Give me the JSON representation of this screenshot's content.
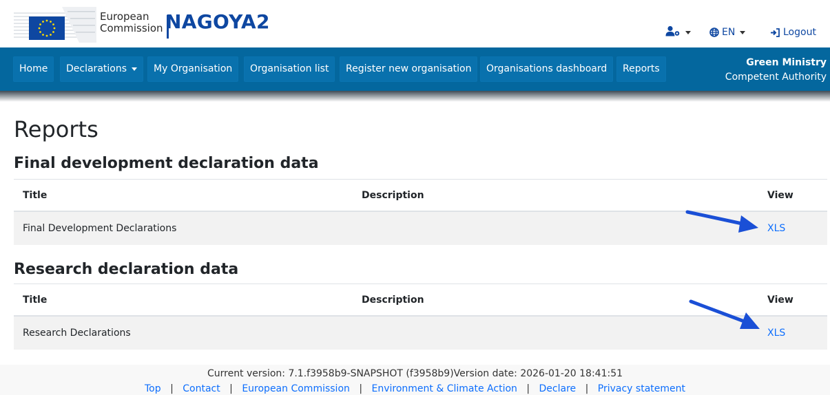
{
  "header": {
    "logo_text_line1": "European",
    "logo_text_line2": "Commission",
    "app_title": "NAGOYA2",
    "user_menu_icon": "user-cog-icon",
    "language_icon": "globe-icon",
    "language": "EN",
    "logout_icon": "sign-out-icon",
    "logout_label": "Logout"
  },
  "navbar": {
    "items": [
      {
        "label": "Home"
      },
      {
        "label": "Declarations",
        "dropdown": true
      },
      {
        "label": "My Organisation"
      },
      {
        "label": "Organisation list"
      },
      {
        "label": "Register new organisation"
      },
      {
        "label": "Organisations dashboard"
      },
      {
        "label": "Reports"
      }
    ],
    "org_name": "Green Ministry",
    "org_role": "Competent Authority"
  },
  "page": {
    "title": "Reports",
    "sections": [
      {
        "heading": "Final development declaration data",
        "columns": [
          "Title",
          "Description",
          "View"
        ],
        "rows": [
          {
            "title": "Final Development Declarations",
            "description": "",
            "view": "XLS"
          }
        ]
      },
      {
        "heading": "Research declaration data",
        "columns": [
          "Title",
          "Description",
          "View"
        ],
        "rows": [
          {
            "title": "Research Declarations",
            "description": "",
            "view": "XLS"
          }
        ]
      }
    ]
  },
  "footer": {
    "version_text": "Current version: 7.1.f3958b9-SNAPSHOT (f3958b9)Version date: 2026-01-20 18:41:51",
    "links": [
      "Top",
      "Contact",
      "European Commission",
      "Environment & Climate Action",
      "Declare",
      "Privacy statement"
    ]
  },
  "colors": {
    "brand_blue": "#0e47a1",
    "navbar_blue": "#04679e",
    "link_blue": "#0d6efd",
    "annotation_arrow": "#1a4fd6"
  }
}
